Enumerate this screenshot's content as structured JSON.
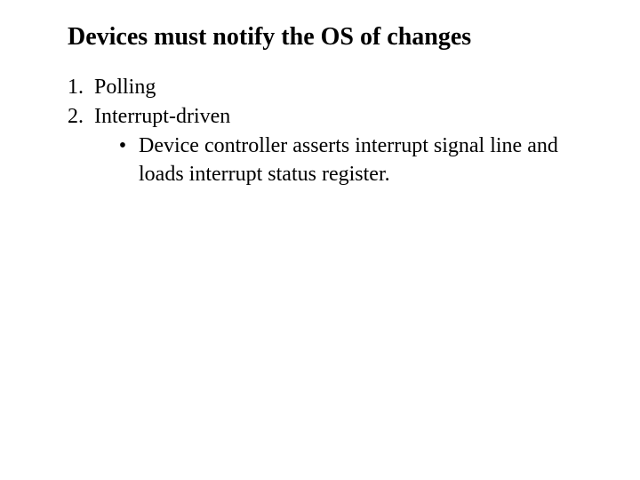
{
  "title": "Devices must notify the OS of changes",
  "list": {
    "item1": "Polling",
    "item2": "Interrupt-driven",
    "sub1_bullet": "•",
    "sub1": "Device controller asserts interrupt signal line and loads interrupt status register."
  }
}
